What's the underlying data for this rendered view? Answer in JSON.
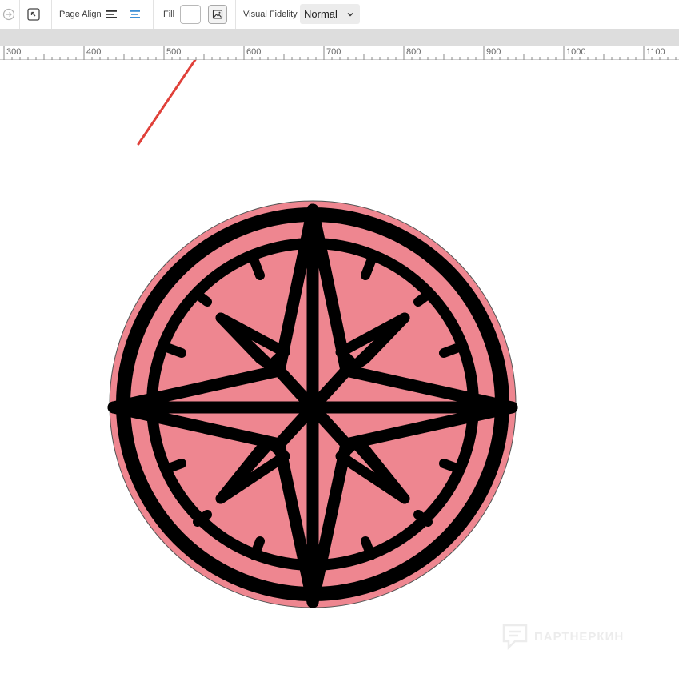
{
  "toolbar": {
    "page_align_label": "Page Align",
    "fill_label": "Fill",
    "visual_fidelity_label": "Visual Fidelity",
    "visual_fidelity_value": "Normal"
  },
  "ruler": {
    "labels": [
      "300",
      "400",
      "500",
      "600",
      "700",
      "800",
      "900",
      "1000",
      "1100"
    ]
  },
  "icons": {
    "toolbar": [
      "export-icon",
      "resize-icon",
      "align-left-icon",
      "align-center-icon",
      "image-fill-icon",
      "chevron-down-icon"
    ],
    "canvas": [
      "compass-rose-icon",
      "red-arrow-annotation"
    ]
  },
  "colors": {
    "compass_fill": "#ee8690",
    "compass_stroke": "#000000",
    "annotation_arrow": "#e0413a",
    "align_active": "#3c8fd6"
  },
  "watermark": {
    "text": "ПАРТНЕРКИН"
  }
}
